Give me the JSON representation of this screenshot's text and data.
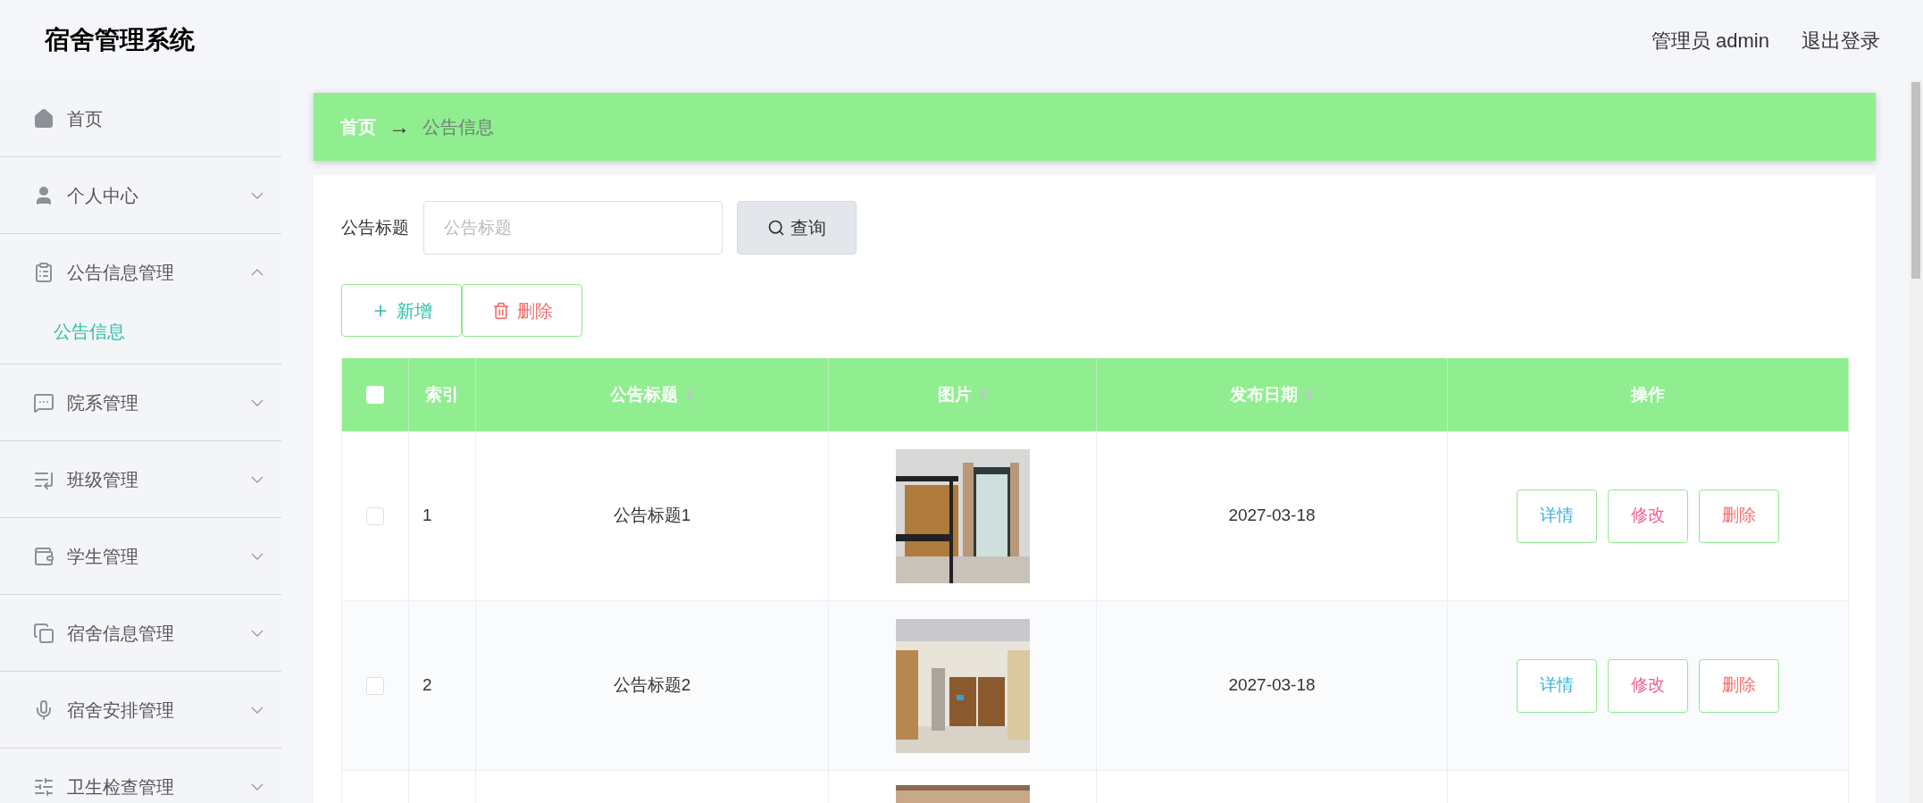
{
  "header": {
    "title": "宿舍管理系统",
    "user": "管理员 admin",
    "logout": "退出登录"
  },
  "sidebar": {
    "items": [
      {
        "label": "首页",
        "kind": "link"
      },
      {
        "label": "个人中心",
        "kind": "menu",
        "expanded": false
      },
      {
        "label": "公告信息管理",
        "kind": "menu",
        "expanded": true,
        "children": [
          {
            "label": "公告信息",
            "selected": true
          }
        ]
      },
      {
        "label": "院系管理",
        "kind": "menu",
        "expanded": false
      },
      {
        "label": "班级管理",
        "kind": "menu",
        "expanded": false
      },
      {
        "label": "学生管理",
        "kind": "menu",
        "expanded": false
      },
      {
        "label": "宿舍信息管理",
        "kind": "menu",
        "expanded": false
      },
      {
        "label": "宿舍安排管理",
        "kind": "menu",
        "expanded": false
      },
      {
        "label": "卫生检查管理",
        "kind": "menu",
        "expanded": false
      }
    ]
  },
  "breadcrumb": [
    "首页",
    "→",
    "公告信息"
  ],
  "search": {
    "label": "公告标题",
    "placeholder": "公告标题",
    "button": "查询"
  },
  "actions": [
    {
      "kind": "add",
      "label": "新增"
    },
    {
      "kind": "delete",
      "label": "删除"
    }
  ],
  "table": {
    "select_all": false,
    "columns": [
      {
        "label": "索引",
        "sortable": false
      },
      {
        "label": "公告标题",
        "sortable": true
      },
      {
        "label": "图片",
        "sortable": true
      },
      {
        "label": "发布日期",
        "sortable": true
      },
      {
        "label": "操作",
        "sortable": false
      }
    ],
    "rows": [
      {
        "checked": false,
        "index": "1",
        "title": "公告标题1",
        "date": "2027-03-18",
        "buttons": [
          {
            "kind": "detail",
            "label": "详情"
          },
          {
            "kind": "edit",
            "label": "修改"
          },
          {
            "kind": "delete",
            "label": "删除"
          }
        ]
      },
      {
        "checked": false,
        "index": "2",
        "title": "公告标题2",
        "date": "2027-03-18",
        "buttons": [
          {
            "kind": "detail",
            "label": "详情"
          },
          {
            "kind": "edit",
            "label": "修改"
          },
          {
            "kind": "delete",
            "label": "删除"
          }
        ]
      },
      {
        "kind": "partial"
      }
    ]
  }
}
